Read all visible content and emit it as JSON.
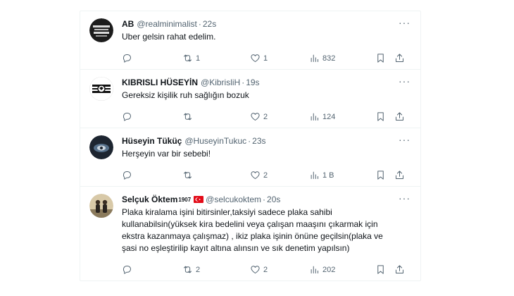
{
  "tweets": [
    {
      "name": "AB",
      "handle": "@realminimalist",
      "dot": "·",
      "time": "22s",
      "text": "Uber gelsin rahat edelim.",
      "replies": "",
      "retweets": "1",
      "likes": "1",
      "views": "832"
    },
    {
      "name": "KIBRISLI HÜSEYİN",
      "handle": "@KibrisliH",
      "dot": "·",
      "time": "19s",
      "text": "Gereksiz kişilik ruh sağlığın bozuk",
      "replies": "",
      "retweets": "",
      "likes": "2",
      "views": "124"
    },
    {
      "name": "Hüseyin Tüküç",
      "handle": "@HuseyinTukuc",
      "dot": "·",
      "time": "23s",
      "text": "Herşeyin var bir sebebi!",
      "replies": "",
      "retweets": "",
      "likes": "2",
      "views": "1 B"
    },
    {
      "name": "Selçuk Öktem",
      "name_sup": "1907",
      "handle": "@selcukoktem",
      "dot": "·",
      "time": "20s",
      "text": "Plaka kiralama işini bitirsinler,taksiyi sadece plaka sahibi kullanabilsin(yüksek kira bedelini veya çalışan maaşını çıkarmak için ekstra kazanmaya çalışmaz) , ikiz plaka işinin önüne geçilsin(plaka ve şasi no eşleştirilip kayıt altına alınsın ve sık denetim yapılsın)",
      "replies": "",
      "retweets": "2",
      "likes": "2",
      "views": "202"
    }
  ],
  "more_label": "···",
  "colors": {
    "text": "#0f1419",
    "muted": "#536471",
    "border": "#eff3f4",
    "flag": "#e30a17"
  },
  "icons": [
    "reply-icon",
    "retweet-icon",
    "like-icon",
    "views-icon",
    "bookmark-icon",
    "share-icon",
    "more-icon",
    "flag-icon"
  ]
}
